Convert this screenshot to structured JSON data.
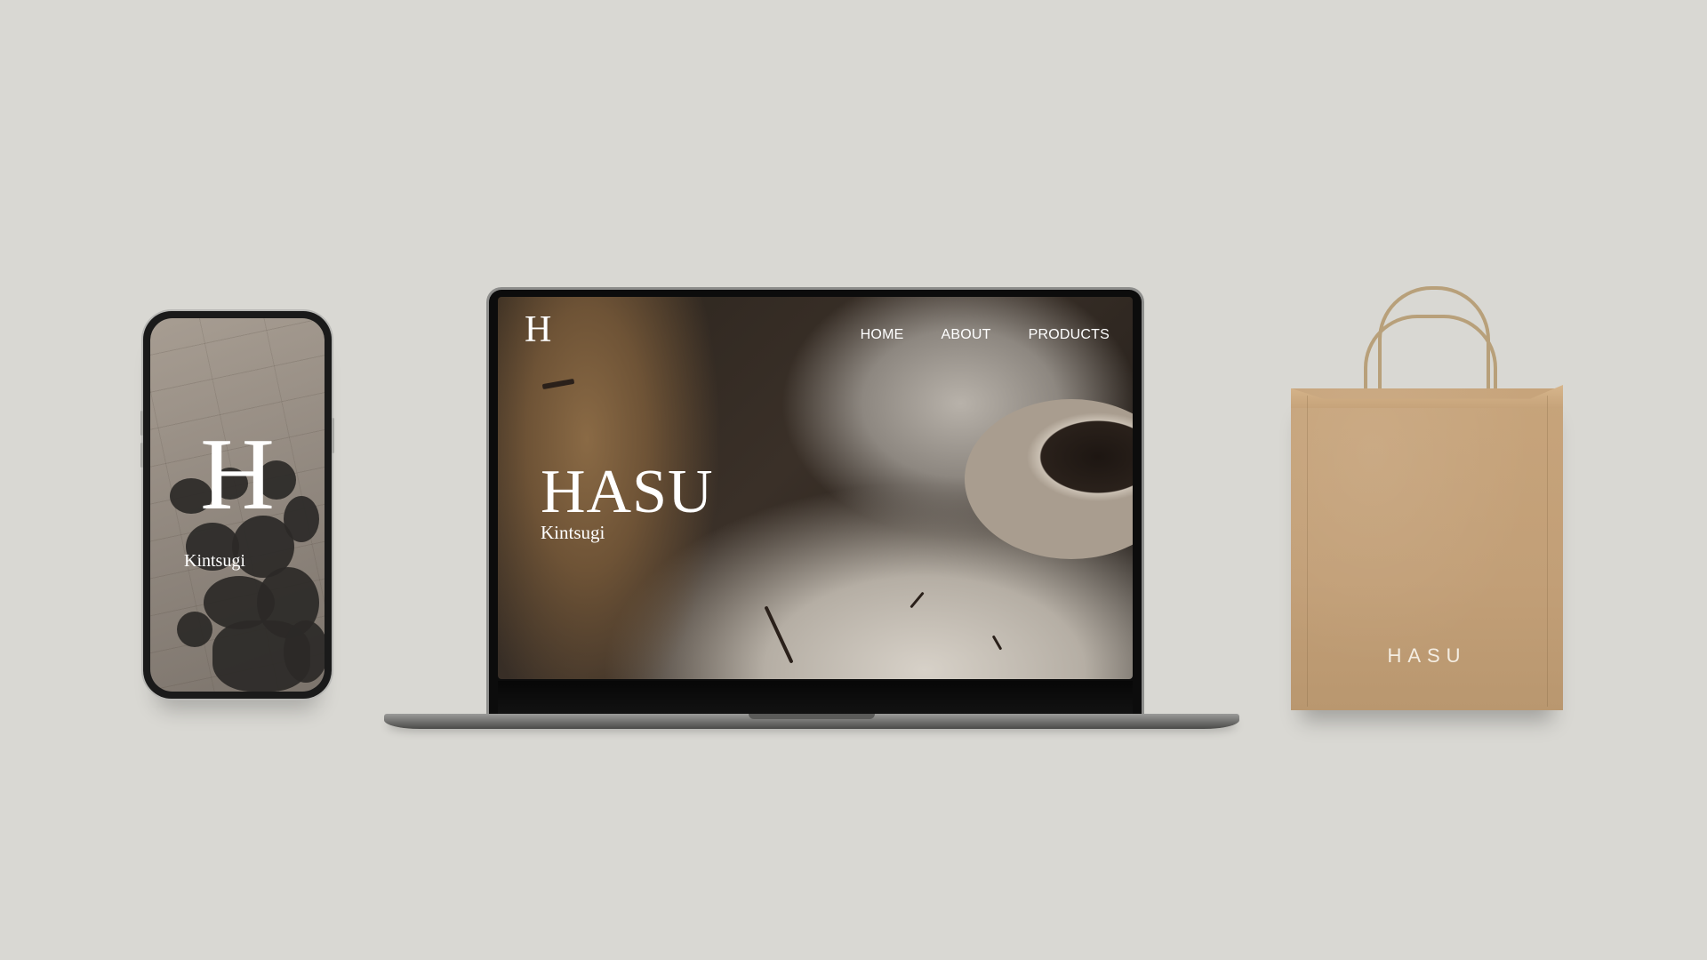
{
  "phone": {
    "logo": "H",
    "subtitle": "Kintsugi"
  },
  "laptop": {
    "logo": "H",
    "nav": [
      "HOME",
      "ABOUT",
      "PRODUCTS"
    ],
    "title": "HASU",
    "subtitle": "Kintsugi"
  },
  "bag": {
    "label": "HASU"
  },
  "colors": {
    "background": "#d9d8d3",
    "kraft": "#c29f77",
    "text_light": "#ffffff"
  }
}
